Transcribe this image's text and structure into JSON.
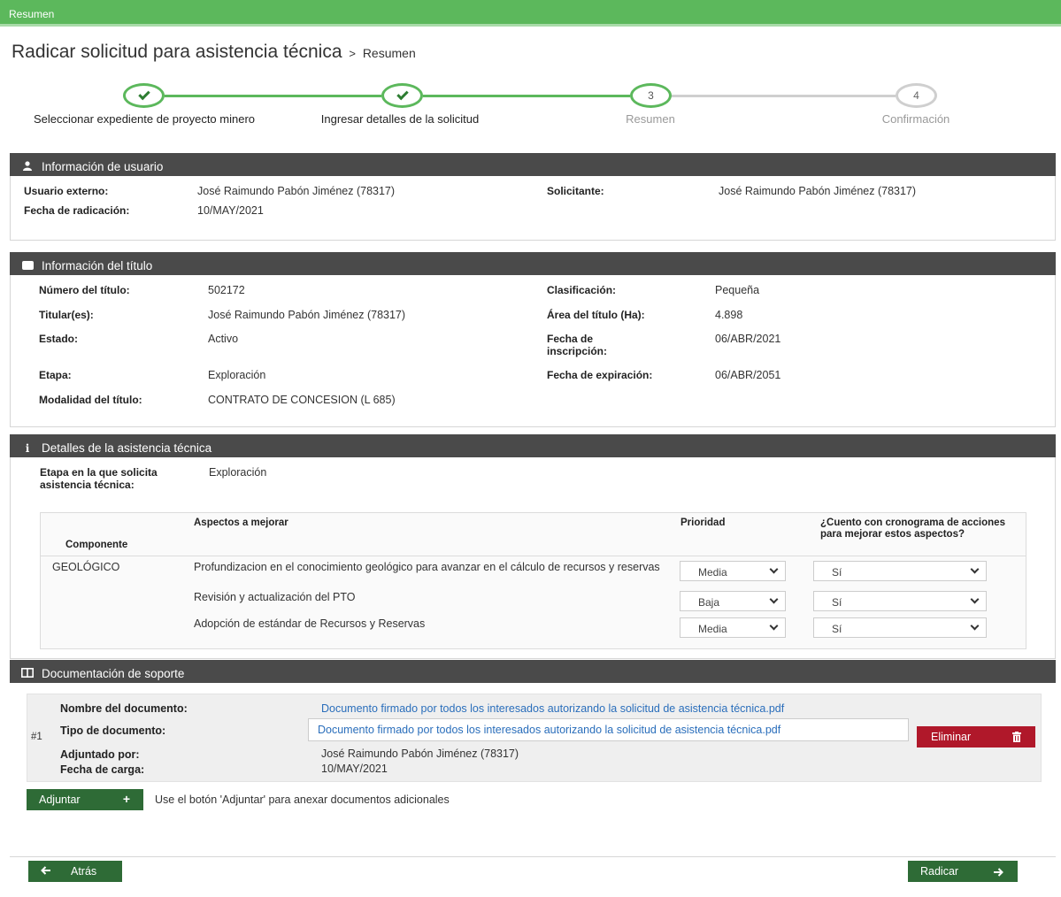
{
  "topbar": {
    "title": "Resumen"
  },
  "header": {
    "title": "Radicar solicitud para asistencia técnica",
    "separator": ">",
    "crumb": "Resumen"
  },
  "steps": [
    {
      "label": "Seleccionar expediente de proyecto minero",
      "number": "1",
      "state": "done"
    },
    {
      "label": "Ingresar detalles de la solicitud",
      "number": "2",
      "state": "done"
    },
    {
      "label": "Resumen",
      "number": "3",
      "state": "current"
    },
    {
      "label": "Confirmación",
      "number": "4",
      "state": "todo"
    }
  ],
  "user_info": {
    "title": "Información de usuario",
    "external_user_label": "Usuario externo:",
    "external_user": "José Raimundo Pabón Jiménez (78317)",
    "applicant_label": "Solicitante:",
    "applicant": "José Raimundo Pabón Jiménez (78317)",
    "date_label": "Fecha de radicación:",
    "date": "10/MAY/2021"
  },
  "title_info": {
    "title": "Información del título",
    "number_label": "Número del título:",
    "number": "502172",
    "classification_label": "Clasificación:",
    "classification": "Pequeña",
    "holders_label": "Titular(es):",
    "holders": "José Raimundo Pabón Jiménez (78317)",
    "area_label": "Área del título (Ha):",
    "area": "4.898",
    "status_label": "Estado:",
    "status": "Activo",
    "inscription_label": "Fecha de inscripción:",
    "inscription": "06/ABR/2021",
    "stage_label": "Etapa:",
    "stage": "Exploración",
    "expiration_label": "Fecha de expiración:",
    "expiration": "06/ABR/2051",
    "modality_label": "Modalidad del título:",
    "modality": "CONTRATO DE CONCESION (L 685)"
  },
  "assistance": {
    "title": "Detalles de la asistencia técnica",
    "stage_label": "Etapa en la que solicita asistencia técnica:",
    "stage": "Exploración",
    "columns": {
      "component": "Componente",
      "aspects": "Aspectos a mejorar",
      "priority": "Prioridad",
      "schedule": "¿Cuento con cronograma de acciones para mejorar estos aspectos?"
    },
    "component": "GEOLÓGICO",
    "rows": [
      {
        "aspect": "Profundizacion en el conocimiento geológico para avanzar en el cálculo de recursos y reservas",
        "priority": "Media",
        "schedule": "Sí"
      },
      {
        "aspect": "Revisión y actualización del PTO",
        "priority": "Baja",
        "schedule": "Sí"
      },
      {
        "aspect": "Adopción de estándar de Recursos y Reservas",
        "priority": "Media",
        "schedule": "Sí"
      }
    ]
  },
  "docs": {
    "title": "Documentación de soporte",
    "index": "#1",
    "name_label": "Nombre del documento:",
    "name": "Documento firmado por todos los interesados autorizando la solicitud de asistencia técnica.pdf",
    "type_label": "Tipo de documento:",
    "type": "Documento firmado por todos los interesados autorizando la solicitud de asistencia técnica.pdf",
    "attached_by_label": "Adjuntado por:",
    "attached_by": "José Raimundo Pabón Jiménez (78317)",
    "upload_date_label": "Fecha de carga:",
    "upload_date": "10/MAY/2021",
    "delete_label": "Eliminar",
    "attach_label": "Adjuntar",
    "attach_hint": "Use el botón 'Adjuntar' para anexar documentos adicionales"
  },
  "footer": {
    "back_label": "Atrás",
    "submit_label": "Radicar"
  },
  "colors": {
    "accent": "#5cb85c",
    "dark_green": "#2e6b36",
    "danger": "#b0182a",
    "panel_header": "#4a4a4a",
    "link": "#2a6ebb"
  }
}
